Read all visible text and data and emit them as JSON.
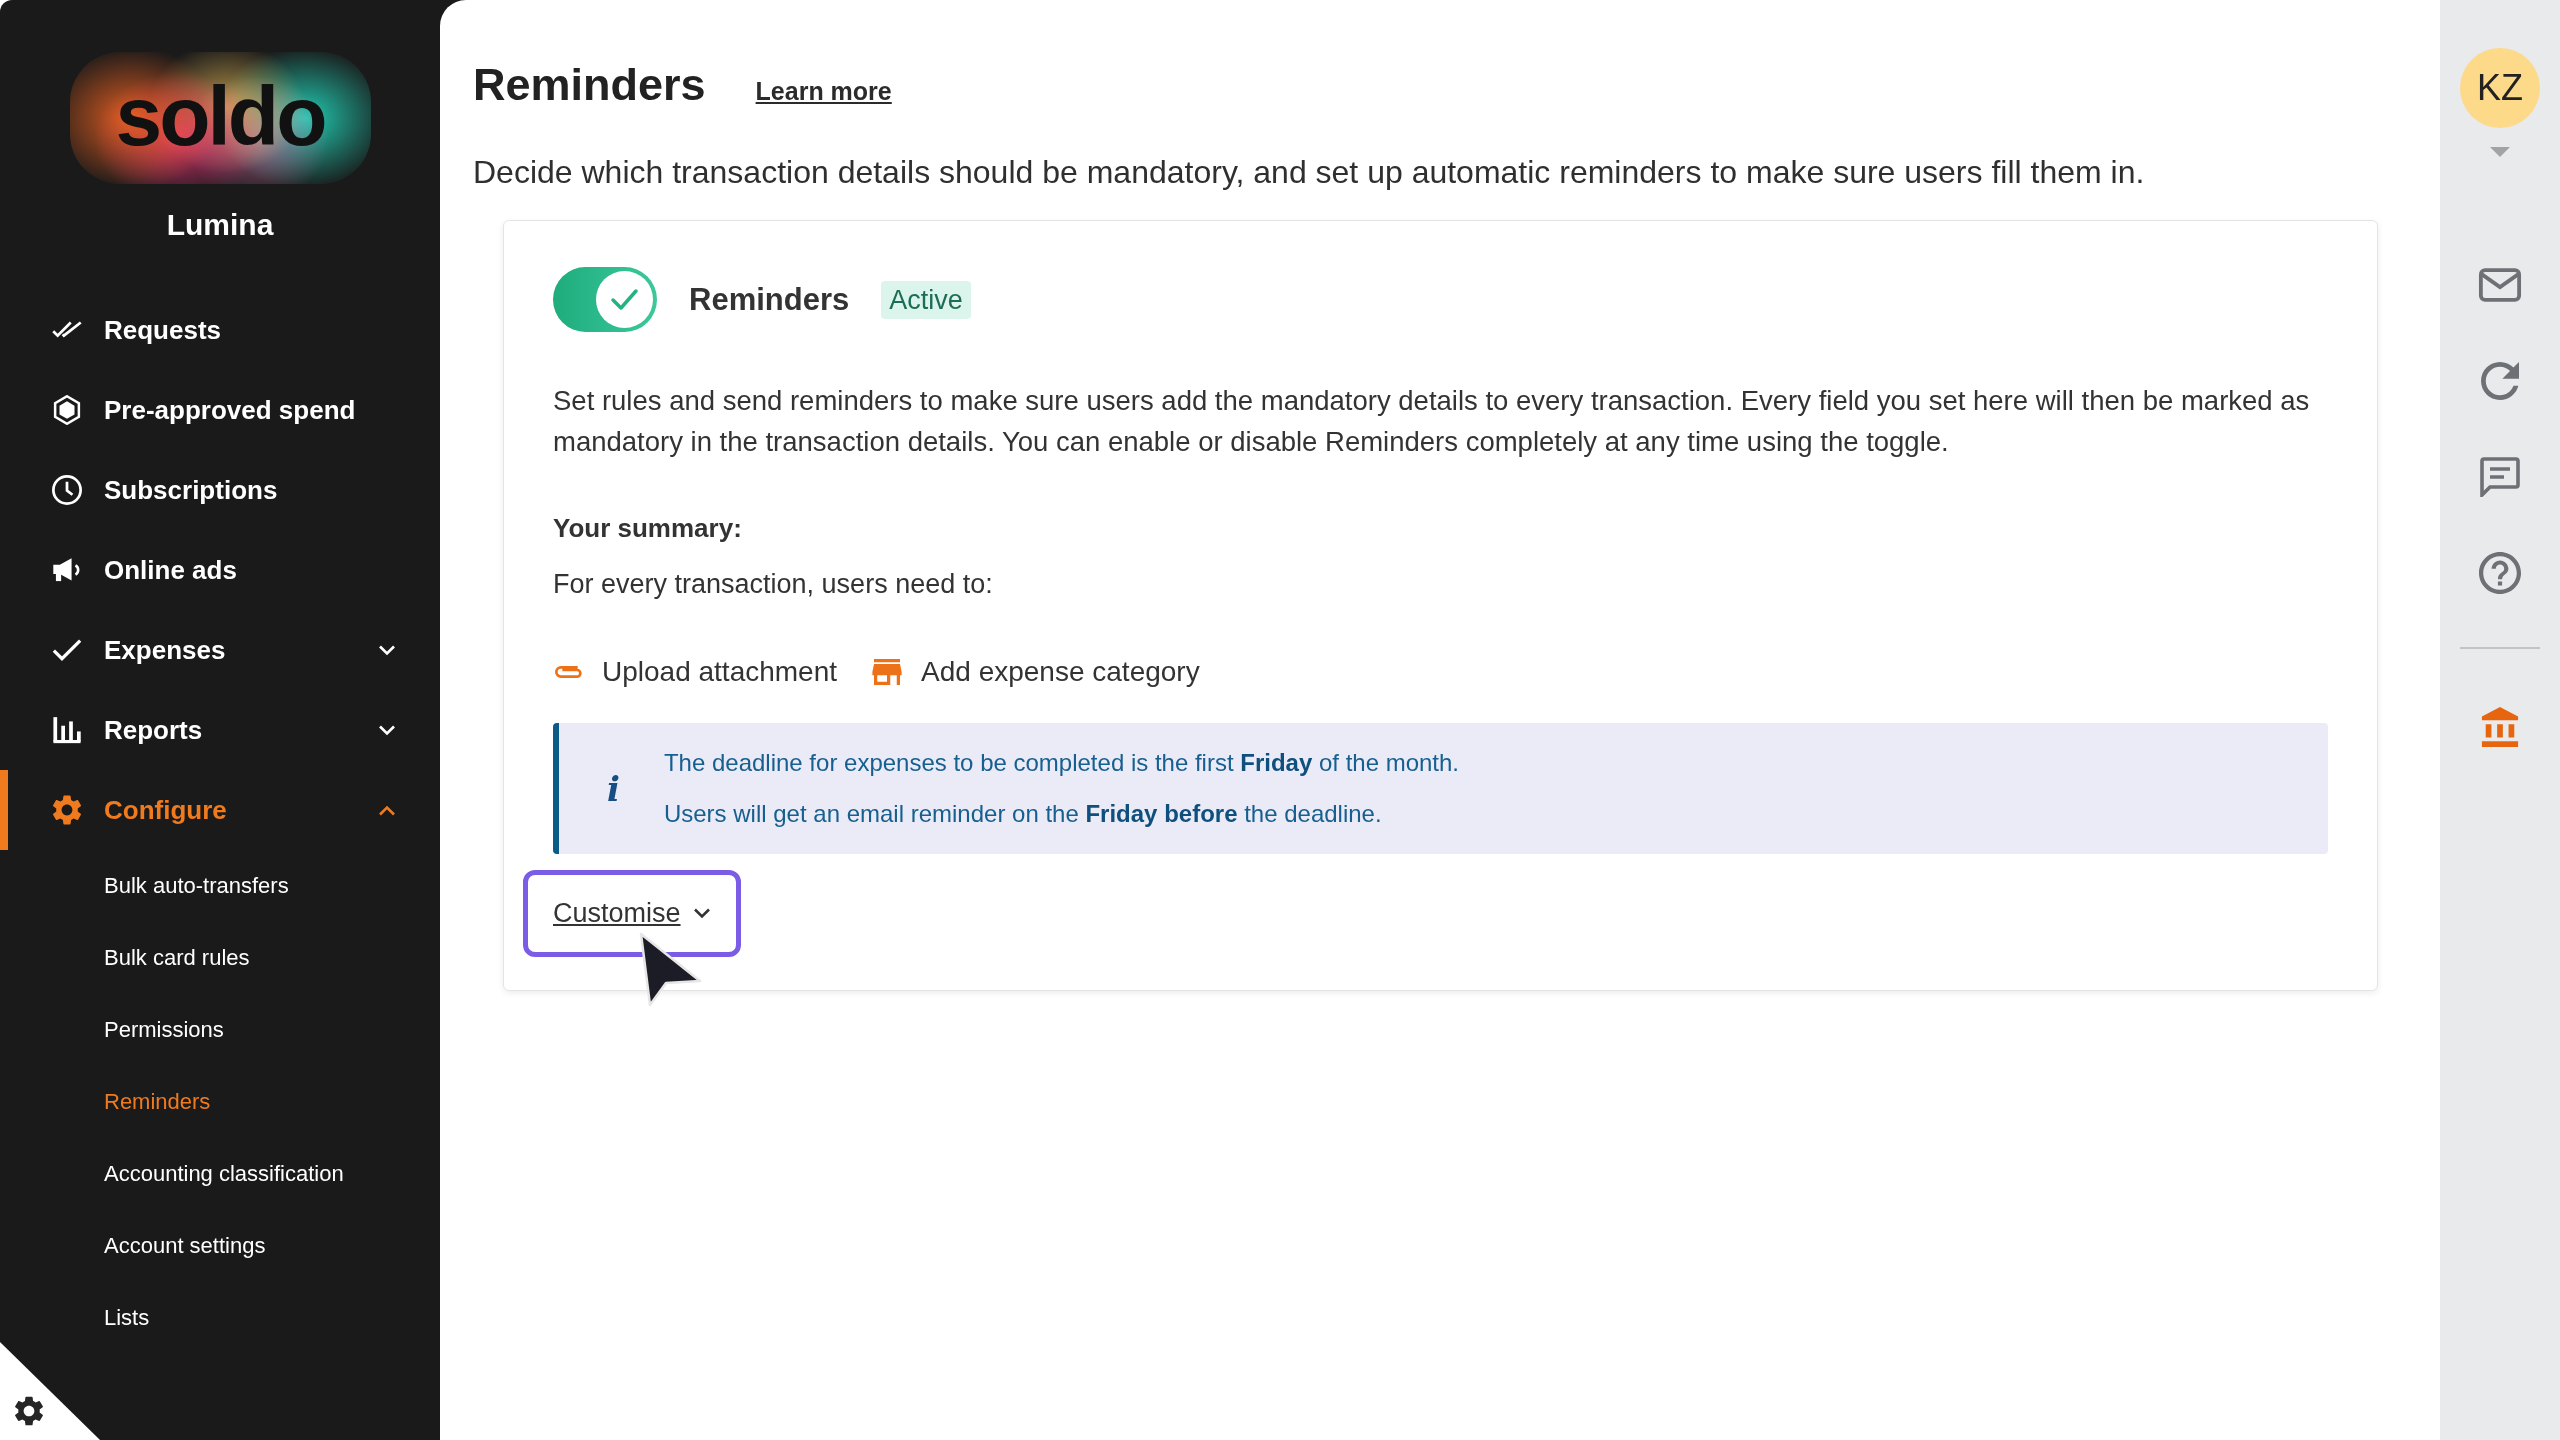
{
  "sidebar": {
    "logo": "soldo",
    "organization": "Lumina",
    "nav": [
      {
        "label": "Requests",
        "selected": false
      },
      {
        "label": "Pre-approved spend",
        "selected": false
      },
      {
        "label": "Subscriptions",
        "selected": false
      },
      {
        "label": "Online ads",
        "selected": false
      },
      {
        "label": "Expenses",
        "selected": false,
        "expanded": false
      },
      {
        "label": "Reports",
        "selected": false,
        "expanded": false
      },
      {
        "label": "Configure",
        "selected": true,
        "expanded": true,
        "children": [
          {
            "label": "Bulk auto-transfers",
            "selected": false
          },
          {
            "label": "Bulk card rules",
            "selected": false
          },
          {
            "label": "Permissions",
            "selected": false
          },
          {
            "label": "Reminders",
            "selected": true
          },
          {
            "label": "Accounting classification",
            "selected": false
          },
          {
            "label": "Account settings",
            "selected": false
          },
          {
            "label": "Lists",
            "selected": false
          }
        ]
      }
    ]
  },
  "header": {
    "title": "Reminders",
    "learn_more": "Learn more",
    "description": "Decide which transaction details should be mandatory, and set up automatic reminders to make sure users fill them in."
  },
  "card": {
    "toggle": {
      "on": true
    },
    "title": "Reminders",
    "status": "Active",
    "intro": "Set rules and send reminders to make sure users add the mandatory details to every transaction. Every field you set here will then be marked as mandatory in the transaction details. You can enable or disable Reminders completely at any time using the toggle.",
    "summary_heading": "Your summary:",
    "summary_lead": "For every transaction, users need to:",
    "requirements": [
      {
        "label": "Upload attachment"
      },
      {
        "label": "Add expense category"
      }
    ],
    "info": {
      "icon": "i",
      "lines": [
        "The deadline for expenses to be completed is the first **Friday** of the month.",
        "Users will get an email reminder on the **Friday before** the deadline."
      ]
    },
    "customise": {
      "label": "Customise",
      "focused": true
    }
  },
  "account": {
    "initials": "KZ"
  }
}
